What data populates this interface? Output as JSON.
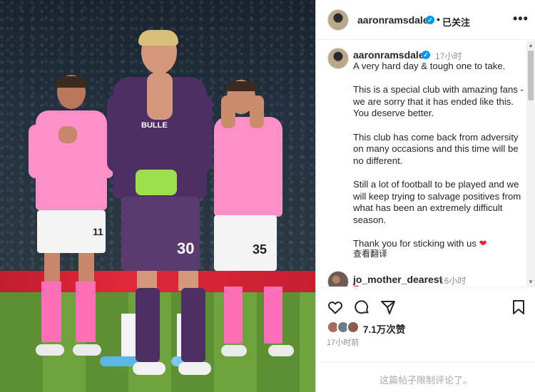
{
  "header": {
    "username": "aaronramsdale",
    "separator": "•",
    "follow_status": "已关注",
    "more": "•••"
  },
  "caption": {
    "username": "aaronramsdale",
    "time": "17小时",
    "paragraphs": [
      "A very hard day & tough one to take.",
      "This is a special club with amazing fans - we are sorry that it has ended like this. You deserve better.",
      "This club has come back from adversity on many occasions and this time will be no different.",
      "Still a lot of football to be played and we will keep trying to salvage positives from what has been an extremely difficult season.",
      "Thank you for sticking with us"
    ],
    "see_translation": "查看翻译"
  },
  "comment": {
    "username": "jo_mother_dearest",
    "time": "16小时"
  },
  "stats": {
    "likes": "7.1万次赞",
    "post_time": "17小时前"
  },
  "footer": {
    "comments_limited": "这篇帖子限制评论了。"
  },
  "photo": {
    "gk_number": "30",
    "player_right_number": "35",
    "player_left_number": "11"
  },
  "colors": {
    "verified_blue": "#0095f6",
    "heart_red": "#ed1c3a",
    "pink_kit": "#ff8fc8",
    "gk_purple": "#4e2f63"
  }
}
